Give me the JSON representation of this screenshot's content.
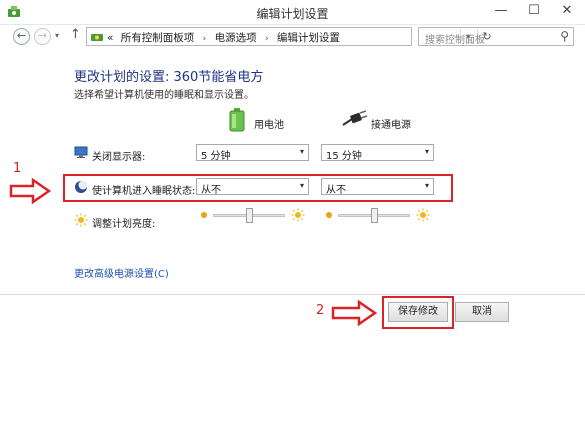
{
  "window": {
    "title": "编辑计划设置",
    "min_glyph": "—",
    "max_glyph": "☐",
    "close_glyph": "✕"
  },
  "nav": {
    "back": "←",
    "forward": "→",
    "recent": "▾",
    "up": "↑"
  },
  "breadcrumb": {
    "chevron": "«",
    "items": [
      "所有控制面板项",
      "电源选项",
      "编辑计划设置"
    ],
    "separator": "›",
    "dropdown": "▾",
    "refresh": "↻"
  },
  "search": {
    "placeholder": "搜索控制面板",
    "icon": "⚲"
  },
  "page": {
    "title": "更改计划的设置: 360节能省电方",
    "subtitle": "选择希望计算机使用的睡眠和显示设置。"
  },
  "columns": {
    "battery": "用电池",
    "plugged": "接通电源"
  },
  "rows": [
    {
      "label": "关闭显示器:",
      "battery_value": "5 分钟",
      "plugged_value": "15 分钟"
    },
    {
      "label": "使计算机进入睡眠状态:",
      "battery_value": "从不",
      "plugged_value": "从不"
    }
  ],
  "brightness": {
    "label": "调整计划亮度:",
    "battery_level": 0.5,
    "plugged_level": 0.5
  },
  "dropdown_arrow": "▾",
  "advanced_link": "更改高级电源设置(C)",
  "buttons": {
    "save": "保存修改",
    "cancel": "取消"
  },
  "annotations": {
    "step1": "1",
    "step2": "2",
    "color": "#d9252a"
  },
  "colors": {
    "title_blue": "#1e3287",
    "link_blue": "#1e50b4",
    "annotation_red": "#d9252a"
  }
}
